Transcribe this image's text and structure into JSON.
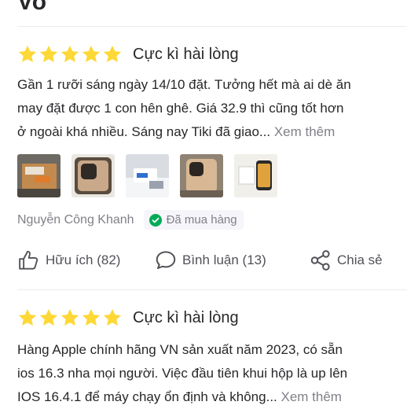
{
  "header_fragment": "Vo",
  "reviews": [
    {
      "rating": 5,
      "title": "Cực kì hài lòng",
      "lines": [
        "Gần 1 rưỡi sáng ngày 14/10 đặt. Tưởng hết mà ai dè ăn",
        "may đặt được 1 con hên ghê. Giá 32.9 thì cũng tốt hơn",
        "ở ngoài khá nhiều. Sáng nay Tiki đã giao..."
      ],
      "see_more": " Xem thêm",
      "author": "Nguyễn Công Khanh",
      "verified": "Đã mua hàng",
      "actions": {
        "helpful": "Hữu ích (82)",
        "comment": "Bình luận (13)",
        "share": "Chia sẻ"
      }
    },
    {
      "rating": 5,
      "title": "Cực kì hài lòng",
      "lines": [
        "Hàng Apple chính hãng VN sản xuất năm 2023, có sẵn",
        "ios 16.3 nha mọi người. Việc đầu tiên khui hộp là up lên",
        "IOS 16.4.1 để máy chạy ổn định và không..."
      ],
      "see_more": " Xem thêm"
    }
  ],
  "colors": {
    "star": "#fdd836",
    "text": "#27272a",
    "muted": "#808089",
    "verified": "#00ab56",
    "divider": "#ebebf0"
  },
  "icons": {
    "star": "star-icon",
    "verified": "check-circle-icon",
    "helpful": "thumbs-up-icon",
    "comment": "comment-bubble-icon",
    "share": "share-icon"
  }
}
